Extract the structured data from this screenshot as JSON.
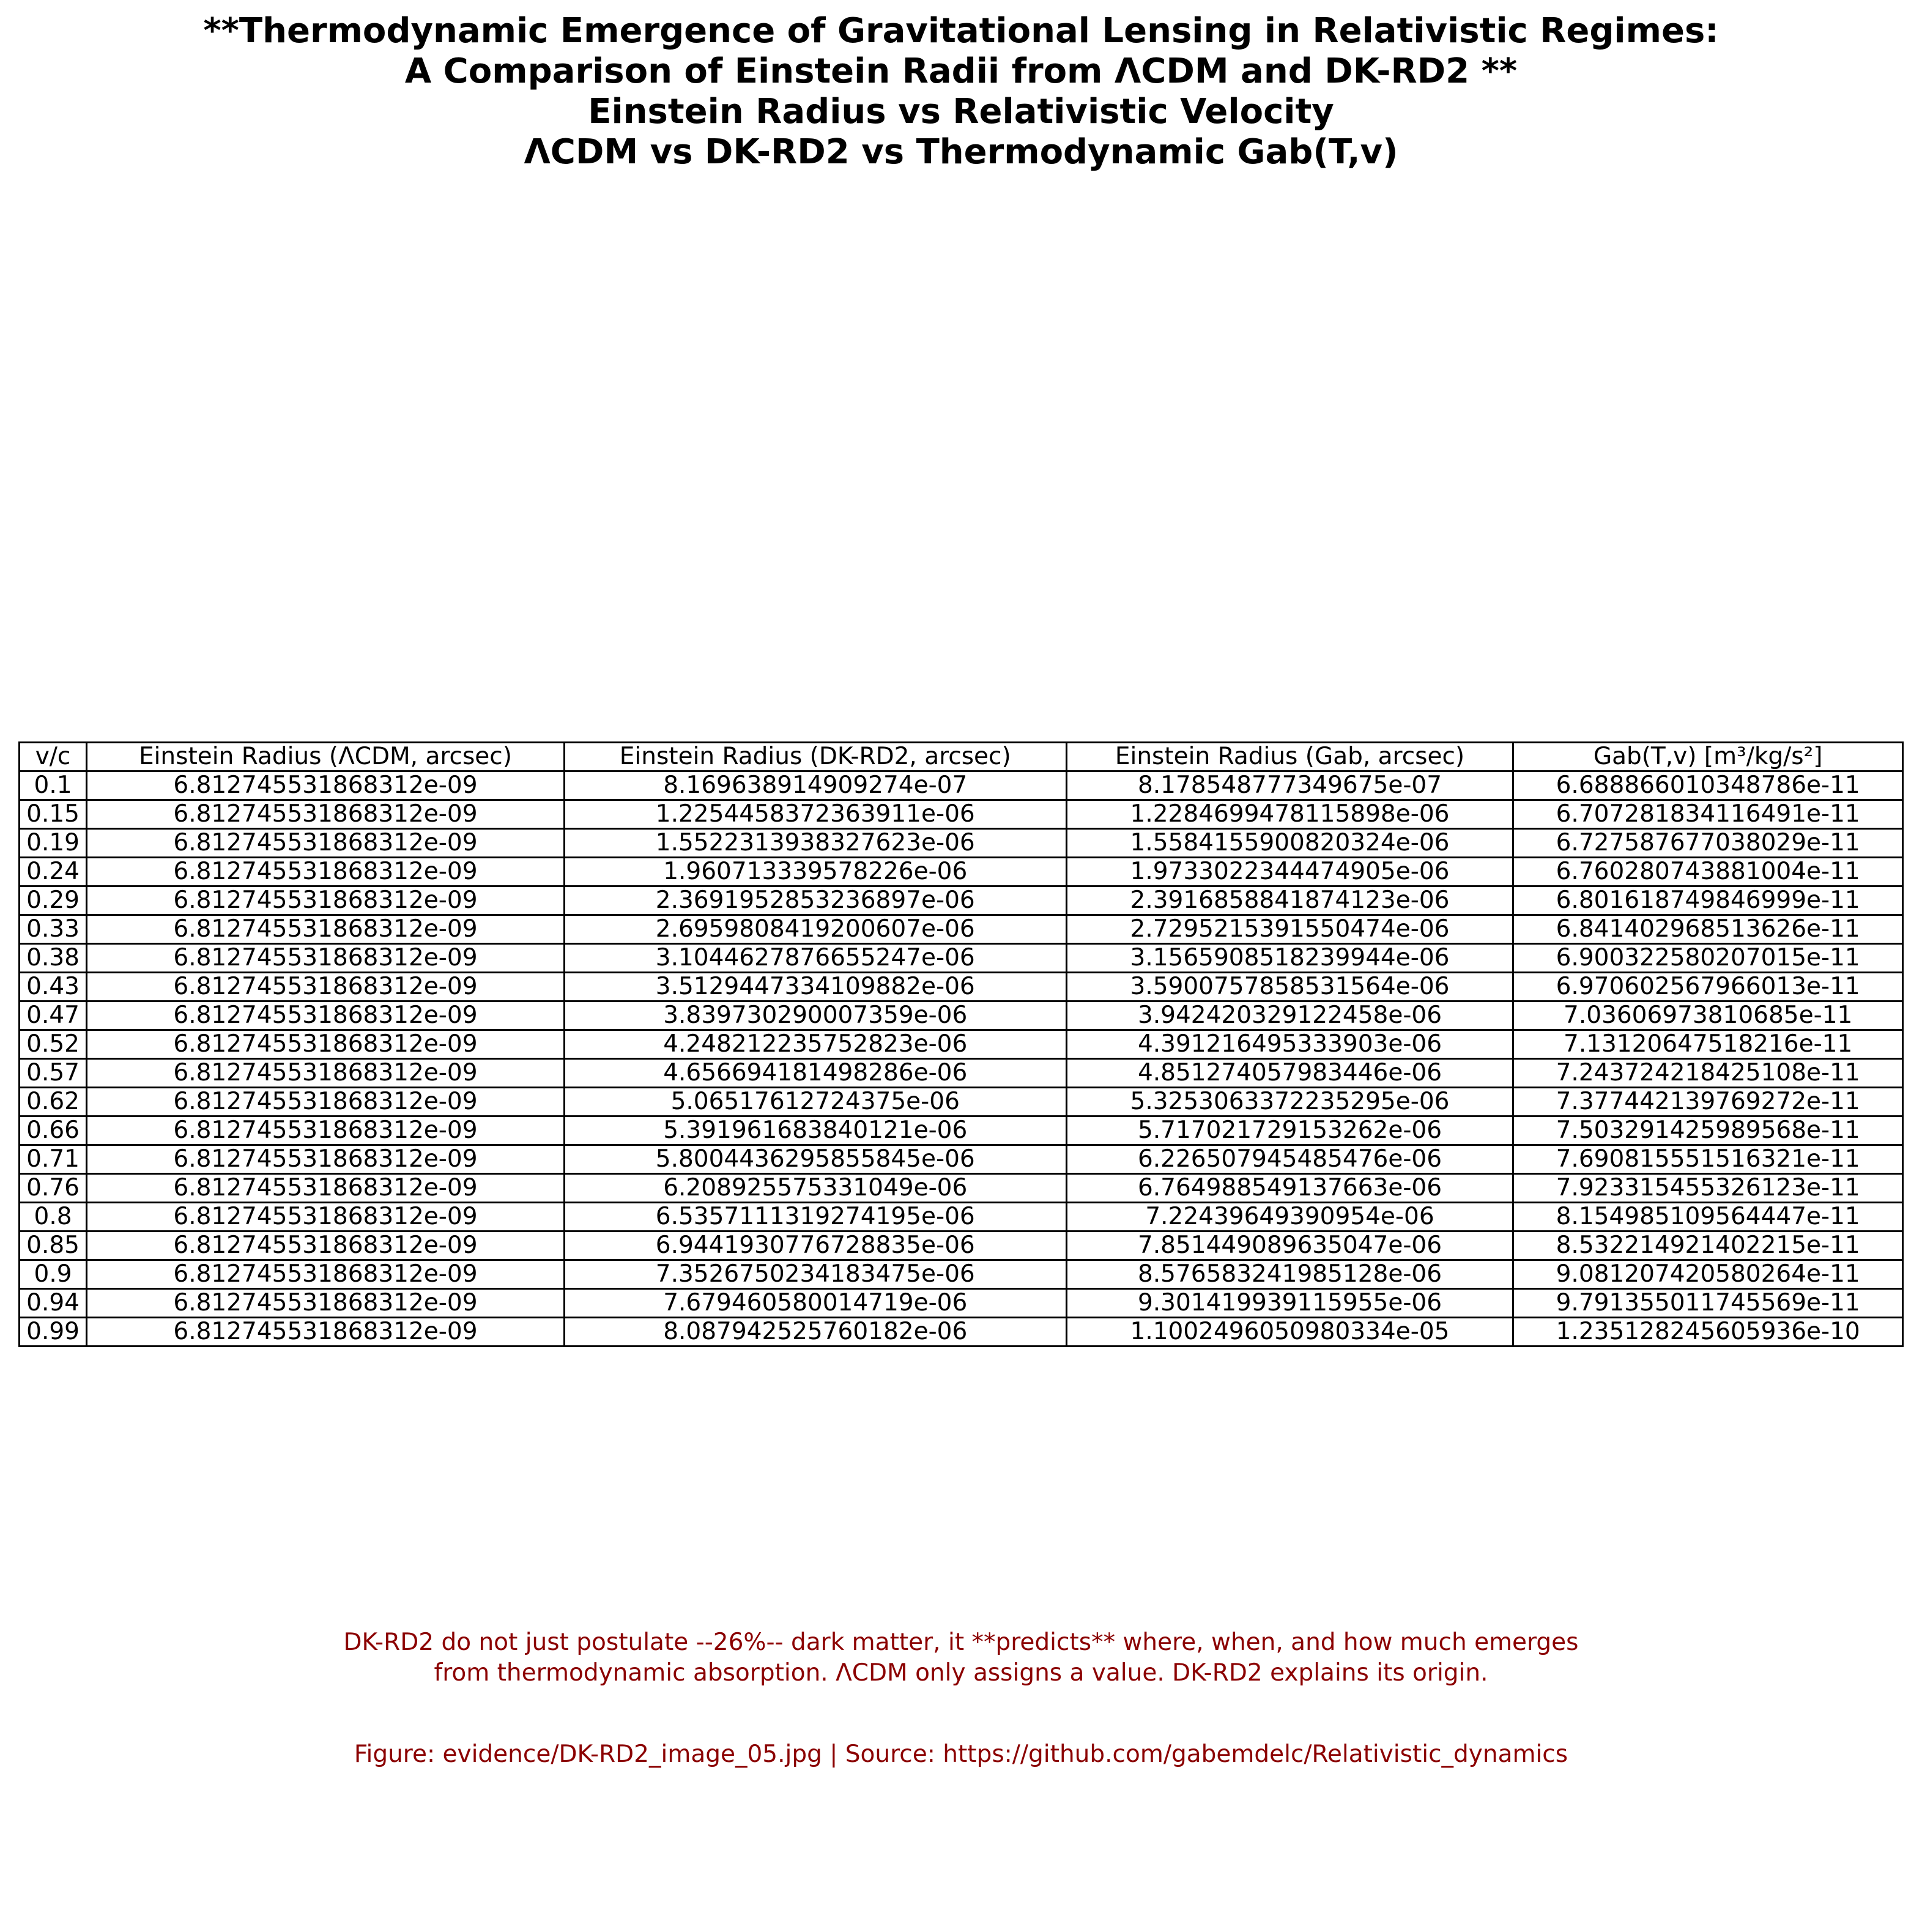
{
  "title_lines": [
    "**Thermodynamic Emergence of Gravitational Lensing in Relativistic Regimes:",
    "A Comparison of Einstein Radii from ΛCDM and DK-RD2 **",
    "Einstein Radius vs Relativistic Velocity",
    "ΛCDM vs DK-RD2 vs Thermodynamic Gab(T,v)"
  ],
  "colors": {
    "note_text": "#8b0000",
    "grid": "#000000"
  },
  "chart_data": {
    "type": "table",
    "columns": [
      "v/c",
      "Einstein Radius (ΛCDM, arcsec)",
      "Einstein Radius (DK-RD2, arcsec)",
      "Einstein Radius (Gab, arcsec)",
      "Gab(T,v) [m³/kg/s²]"
    ],
    "rows": [
      [
        "0.1",
        "6.812745531868312e-09",
        "8.169638914909274e-07",
        "8.178548777349675e-07",
        "6.688866010348786e-11"
      ],
      [
        "0.15",
        "6.812745531868312e-09",
        "1.2254458372363911e-06",
        "1.2284699478115898e-06",
        "6.707281834116491e-11"
      ],
      [
        "0.19",
        "6.812745531868312e-09",
        "1.5522313938327623e-06",
        "1.5584155900820324e-06",
        "6.727587677038029e-11"
      ],
      [
        "0.24",
        "6.812745531868312e-09",
        "1.960713339578226e-06",
        "1.9733022344474905e-06",
        "6.760280743881004e-11"
      ],
      [
        "0.29",
        "6.812745531868312e-09",
        "2.3691952853236897e-06",
        "2.3916858841874123e-06",
        "6.801618749846999e-11"
      ],
      [
        "0.33",
        "6.812745531868312e-09",
        "2.6959808419200607e-06",
        "2.7295215391550474e-06",
        "6.841402968513626e-11"
      ],
      [
        "0.38",
        "6.812745531868312e-09",
        "3.1044627876655247e-06",
        "3.1565908518239944e-06",
        "6.900322580207015e-11"
      ],
      [
        "0.43",
        "6.812745531868312e-09",
        "3.5129447334109882e-06",
        "3.5900757858531564e-06",
        "6.970602567966013e-11"
      ],
      [
        "0.47",
        "6.812745531868312e-09",
        "3.839730290007359e-06",
        "3.942420329122458e-06",
        "7.03606973810685e-11"
      ],
      [
        "0.52",
        "6.812745531868312e-09",
        "4.248212235752823e-06",
        "4.391216495333903e-06",
        "7.13120647518216e-11"
      ],
      [
        "0.57",
        "6.812745531868312e-09",
        "4.656694181498286e-06",
        "4.851274057983446e-06",
        "7.243724218425108e-11"
      ],
      [
        "0.62",
        "6.812745531868312e-09",
        "5.06517612724375e-06",
        "5.3253063372235295e-06",
        "7.377442139769272e-11"
      ],
      [
        "0.66",
        "6.812745531868312e-09",
        "5.391961683840121e-06",
        "5.717021729153262e-06",
        "7.503291425989568e-11"
      ],
      [
        "0.71",
        "6.812745531868312e-09",
        "5.8004436295855845e-06",
        "6.226507945485476e-06",
        "7.690815551516321e-11"
      ],
      [
        "0.76",
        "6.812745531868312e-09",
        "6.208925575331049e-06",
        "6.764988549137663e-06",
        "7.923315455326123e-11"
      ],
      [
        "0.8",
        "6.812745531868312e-09",
        "6.5357111319274195e-06",
        "7.22439649390954e-06",
        "8.154985109564447e-11"
      ],
      [
        "0.85",
        "6.812745531868312e-09",
        "6.9441930776728835e-06",
        "7.851449089635047e-06",
        "8.532214921402215e-11"
      ],
      [
        "0.9",
        "6.812745531868312e-09",
        "7.3526750234183475e-06",
        "8.576583241985128e-06",
        "9.081207420580264e-11"
      ],
      [
        "0.94",
        "6.812745531868312e-09",
        "7.679460580014719e-06",
        "9.301419939115955e-06",
        "9.791355011745569e-11"
      ],
      [
        "0.99",
        "6.812745531868312e-09",
        "8.087942525760182e-06",
        "1.1002496050980334e-05",
        "1.235128245605936e-10"
      ]
    ]
  },
  "note_lines": [
    "DK-RD2 do not just postulate --26%-- dark matter, it **predicts** where, when, and how much emerges",
    "from thermodynamic absorption. ΛCDM only assigns a value. DK-RD2 explains its origin."
  ],
  "source_line": "Figure: evidence/DK-RD2_image_05.jpg | Source: https://github.com/gabemdelc/Relativistic_dynamics"
}
